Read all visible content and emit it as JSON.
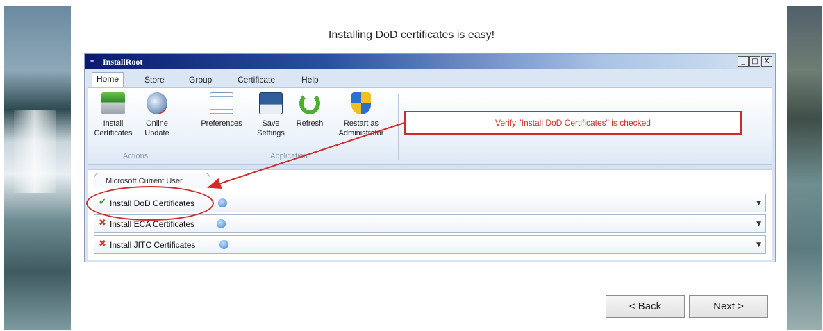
{
  "headline": "Installing DoD certificates is easy!",
  "window": {
    "title": "InstallRoot",
    "controls": [
      "_",
      "□",
      "X"
    ]
  },
  "tabs": [
    "Home",
    "Store",
    "Group",
    "Certificate",
    "Help"
  ],
  "active_tab": "Home",
  "ribbon": {
    "actions": {
      "group_label": "Actions",
      "buttons": [
        {
          "label_line1": "Install",
          "label_line2": "Certificates",
          "icon": "install-certificates-icon"
        },
        {
          "label_line1": "Online",
          "label_line2": "Update",
          "icon": "globe-update-icon"
        }
      ]
    },
    "application": {
      "group_label": "Application",
      "buttons": [
        {
          "label_line1": "Preferences",
          "label_line2": "",
          "icon": "preferences-icon"
        },
        {
          "label_line1": "Save",
          "label_line2": "Settings",
          "icon": "floppy-disk-icon"
        },
        {
          "label_line1": "Refresh",
          "label_line2": "",
          "icon": "refresh-icon"
        },
        {
          "label_line1": "Restart as",
          "label_line2": "Administrator",
          "icon": "shield-icon"
        }
      ]
    }
  },
  "callout": "Verify \"Install DoD Certificates\" is checked",
  "content_tab": "Microsoft Current User",
  "rows": [
    {
      "status": "✔",
      "status_color": "#3a9b2a",
      "label": "Install DoD Certificates"
    },
    {
      "status": "✖",
      "status_color": "#d63a2a",
      "label": "Install ECA Certificates"
    },
    {
      "status": "✖",
      "status_color": "#d63a2a",
      "label": "Install JITC Certificates"
    }
  ],
  "buttons": {
    "back": "< Back",
    "next": "Next >"
  },
  "colors": {
    "annotation": "#d02b2b",
    "titlebar": "#0a1b6e"
  }
}
